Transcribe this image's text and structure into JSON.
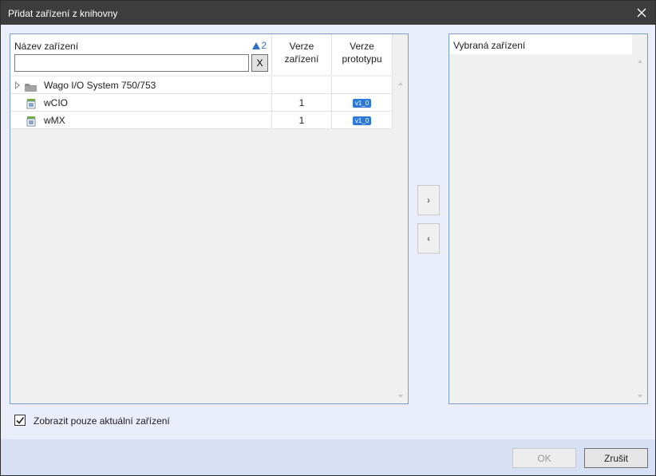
{
  "window": {
    "title": "Přidat zařízení z knihovny"
  },
  "left_panel": {
    "columns": {
      "name": "Název zařízení",
      "sort_indicator": "2",
      "version_line1": "Verze",
      "version_line2": "zařízení",
      "prototype_line1": "Verze",
      "prototype_line2": "prototypu"
    },
    "search": {
      "value": "",
      "placeholder": "",
      "clear_label": "X"
    },
    "rows": [
      {
        "name": "Wago I/O System 750/753",
        "version": "",
        "prototype": "",
        "icon": "folder-icon",
        "expandable": true
      },
      {
        "name": "wCIO",
        "version": "1",
        "prototype": "v1_0",
        "icon": "device-icon"
      },
      {
        "name": "wMX",
        "version": "1",
        "prototype": "v1_0",
        "icon": "device-icon"
      }
    ]
  },
  "right_panel": {
    "header": "Vybraná zařízení"
  },
  "move_buttons": {
    "add": "›",
    "remove": "‹"
  },
  "checkbox": {
    "label": "Zobrazit pouze aktuální zařízení",
    "checked": true
  },
  "footer": {
    "ok_label": "OK",
    "cancel_label": "Zrušit"
  },
  "colors": {
    "accent": "#2f6fc4",
    "badge": "#2d7ad6",
    "titlebar": "#3d3d3d",
    "panel_border": "#7a9cd3"
  }
}
